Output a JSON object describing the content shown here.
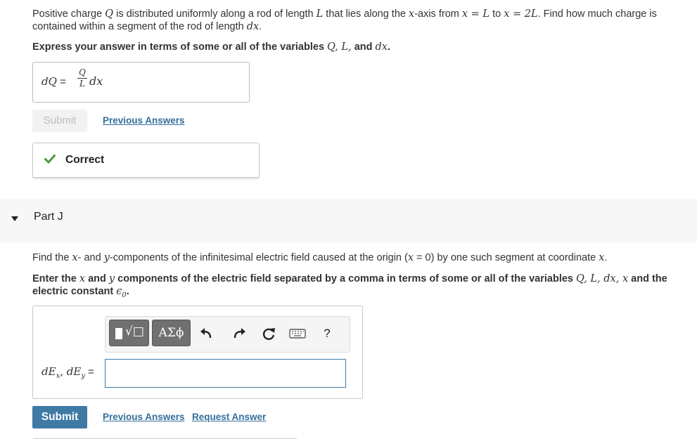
{
  "question": {
    "text_1": "Positive charge ",
    "var_Q": "Q",
    "text_2": " is distributed uniformly along a rod of length ",
    "var_L": "L",
    "text_3": " that lies along the ",
    "var_x": "x",
    "text_4": "-axis from ",
    "eq1": "x = L",
    "text_5": " to ",
    "eq2": "x = 2L",
    "text_6": ". Find how much charge is contained within a segment of the rod of length ",
    "var_dx": "dx",
    "text_7": "."
  },
  "instruction_1": {
    "text": "Express your answer in terms of some or all of the variables ",
    "vars": "Q, L,",
    "and": " and ",
    "last_var": "dx",
    "end": "."
  },
  "answer_1": {
    "label": "dQ",
    "equals": " = ",
    "numerator": "Q",
    "denominator": "L",
    "tail": "dx"
  },
  "submit_disabled_label": "Submit",
  "previous_answers_label": "Previous Answers",
  "feedback": {
    "text": "Correct",
    "color": "#4a9a3c"
  },
  "part": {
    "label": "Part J"
  },
  "part_question": {
    "text_1": "Find the ",
    "var_x": "x",
    "text_2": "- and ",
    "var_y": "y",
    "text_3": "-components of the infinitesimal electric field caused at the origin (",
    "eq": "x",
    "text_4": " = 0) by one such segment at coordinate ",
    "var_x2": "x",
    "text_5": "."
  },
  "instruction_2": {
    "text_1": "Enter the ",
    "var_x": "x",
    "text_2": " and ",
    "var_y": "y",
    "text_3": " components of the electric field separated by a comma in terms of some or all of the variables ",
    "vars": "Q, L, dx, x",
    "text_4": " and the electric constant ",
    "eps": "ϵ",
    "eps_sub": "0",
    "end": "."
  },
  "toolbar": {
    "templates_label": "√□",
    "symbols_label": "ΑΣϕ",
    "undo_icon": "undo-icon",
    "redo_icon": "redo-icon",
    "reset_icon": "reset-icon",
    "keyboard_icon": "keyboard-icon",
    "help_label": "?"
  },
  "answer_2": {
    "label_1": "dE",
    "sub_1": "x",
    "sep": ", ",
    "label_2": "dE",
    "sub_2": "y",
    "equals": " =",
    "value": ""
  },
  "submit_label": "Submit",
  "previous_answers_label_2": "Previous Answers",
  "request_answer_label": "Request Answer",
  "colors": {
    "accent": "#3f7aa5",
    "link": "#336f9a",
    "check": "#4a9a3c"
  }
}
